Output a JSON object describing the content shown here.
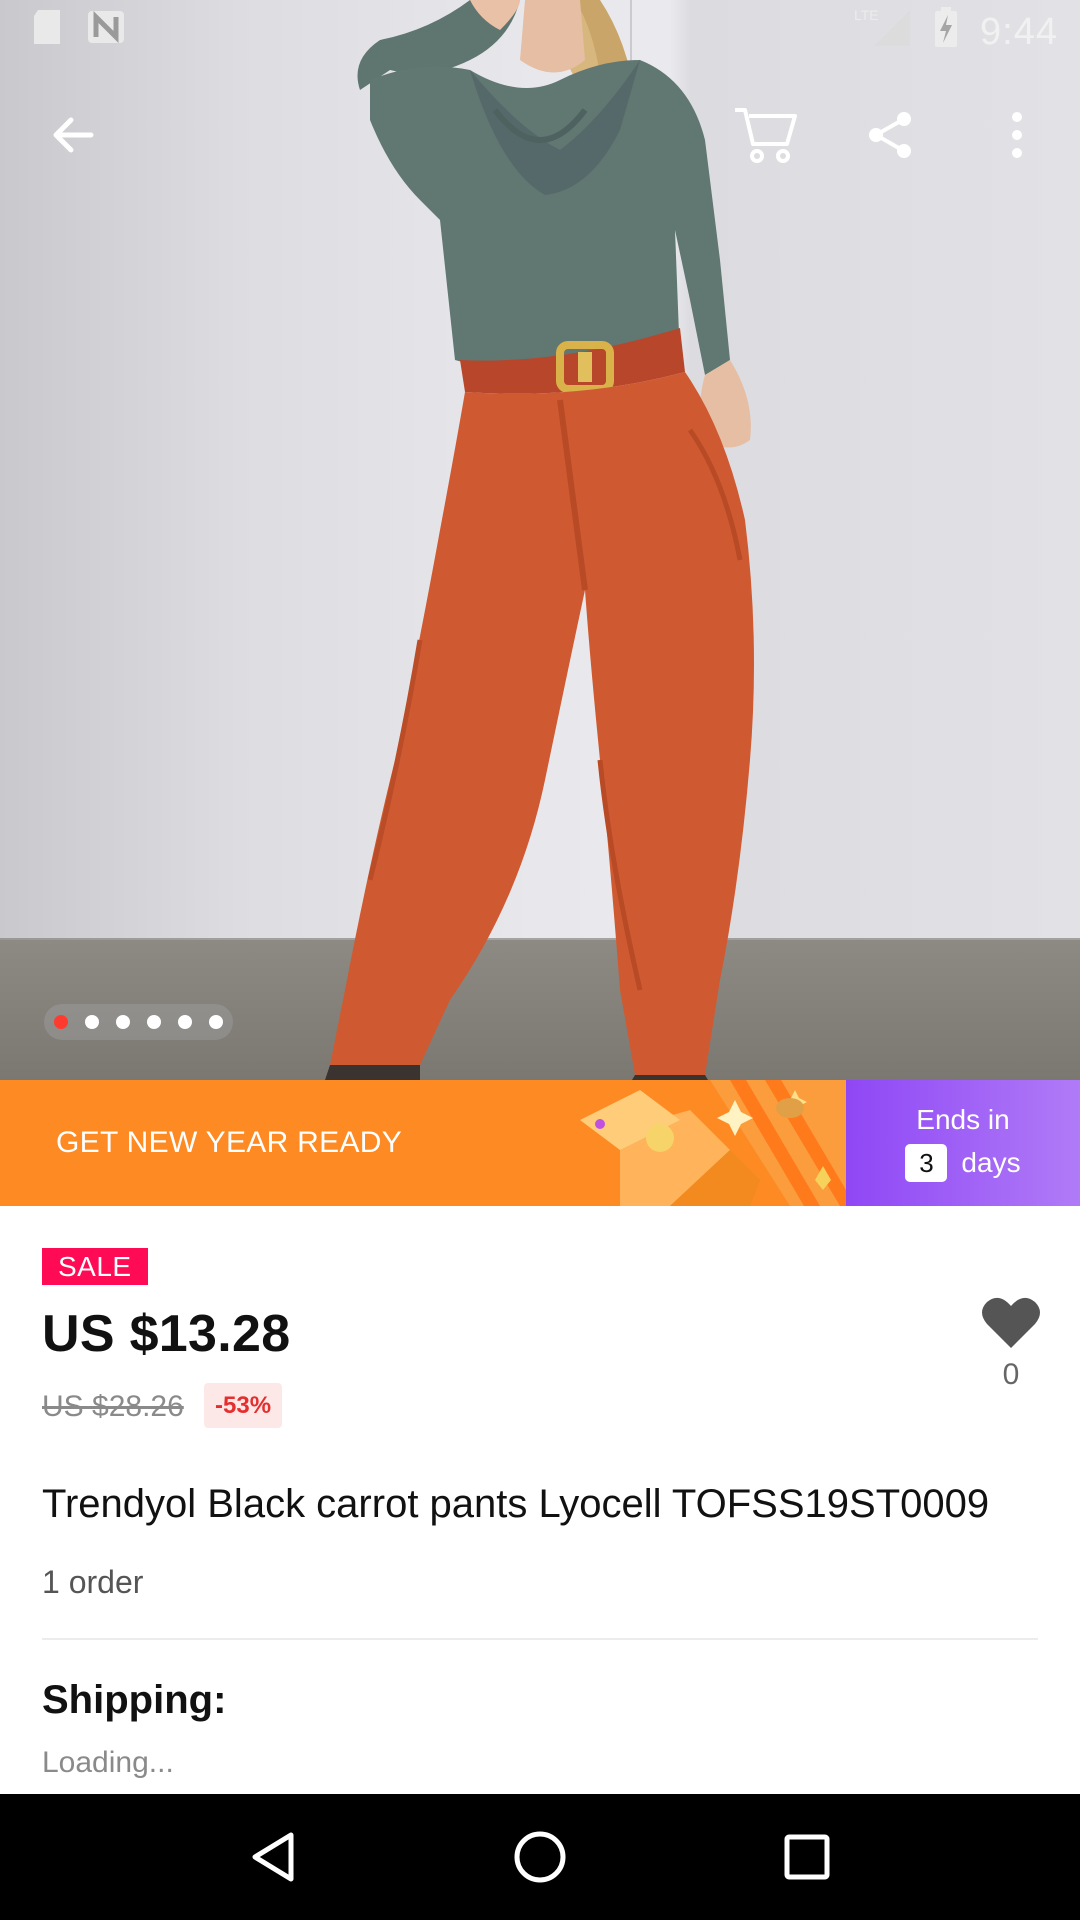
{
  "status_bar": {
    "network_label": "LTE",
    "time": "9:44",
    "left_icons": [
      "sd-card-icon",
      "nfc-icon"
    ],
    "right_icons": [
      "signal-icon",
      "battery-charging-icon"
    ]
  },
  "toolbar": {
    "back_icon": "arrow-left-icon",
    "cart_icon": "cart-icon",
    "share_icon": "share-icon",
    "more_icon": "more-vertical-icon"
  },
  "gallery": {
    "image_count": 6,
    "active_index": 0,
    "active_dot_color": "#ff3b30"
  },
  "promo": {
    "title": "GET NEW YEAR READY",
    "ends_label": "Ends in",
    "days_value": "3",
    "days_unit": "days",
    "left_color": "#fd8a22",
    "right_color": "#9b5cf6"
  },
  "product": {
    "sale_badge": "SALE",
    "price": "US $13.28",
    "original_price": "US $28.26",
    "discount": "-53%",
    "wishlist_count": "0",
    "title": "Trendyol Black carrot pants Lyocell TOFSS19ST0009",
    "orders": "1 order"
  },
  "shipping": {
    "label": "Shipping:",
    "value": "Loading..."
  },
  "nav_bar": {
    "back_icon": "nav-back-icon",
    "home_icon": "nav-home-icon",
    "recents_icon": "nav-recents-icon"
  },
  "colors": {
    "sale_badge": "#ff0a54",
    "discount_text": "#e62e2e",
    "discount_bg": "#fde8e8"
  }
}
